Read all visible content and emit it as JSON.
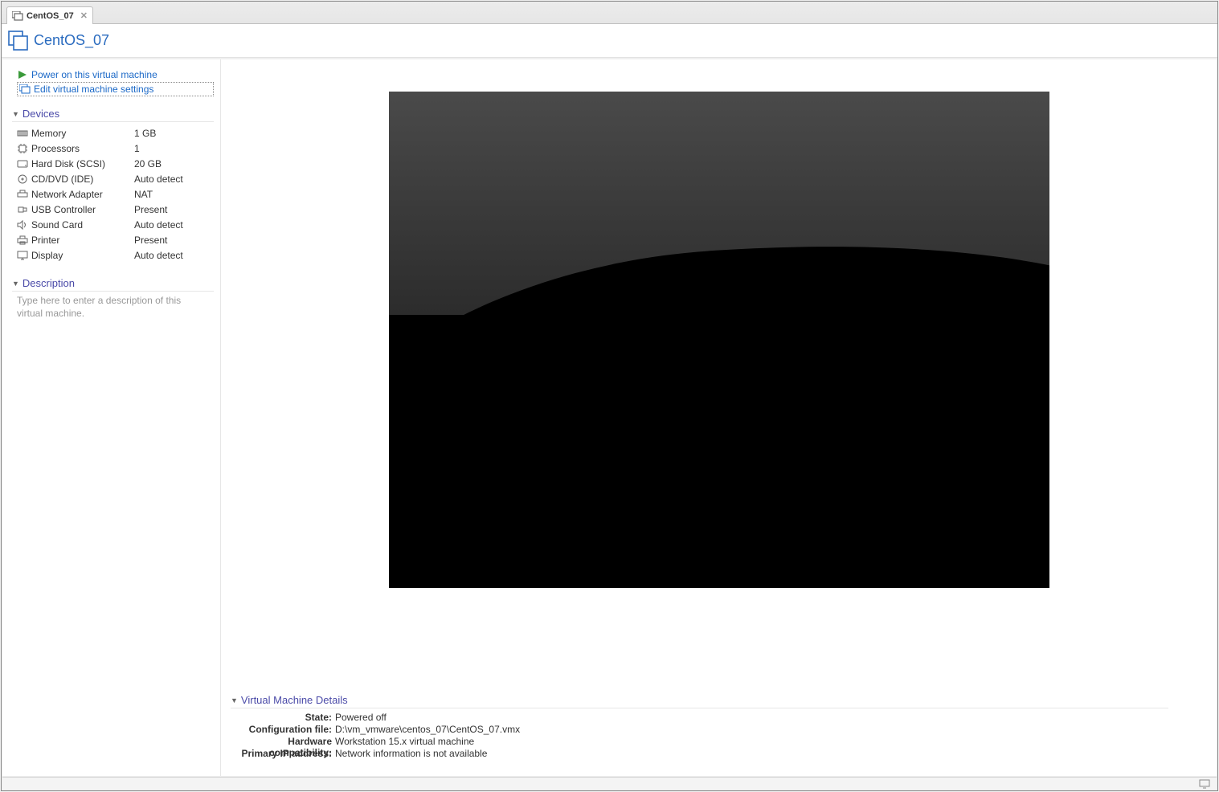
{
  "tab": {
    "title": "CentOS_07"
  },
  "vm": {
    "title": "CentOS_07"
  },
  "actions": {
    "power_on": "Power on this virtual machine",
    "edit_settings": "Edit virtual machine settings"
  },
  "devices": {
    "header": "Devices",
    "rows": [
      {
        "name": "Memory",
        "value": "1 GB"
      },
      {
        "name": "Processors",
        "value": "1"
      },
      {
        "name": "Hard Disk (SCSI)",
        "value": "20 GB"
      },
      {
        "name": "CD/DVD (IDE)",
        "value": "Auto detect"
      },
      {
        "name": "Network Adapter",
        "value": "NAT"
      },
      {
        "name": "USB Controller",
        "value": "Present"
      },
      {
        "name": "Sound Card",
        "value": "Auto detect"
      },
      {
        "name": "Printer",
        "value": "Present"
      },
      {
        "name": "Display",
        "value": "Auto detect"
      }
    ]
  },
  "description": {
    "header": "Description",
    "placeholder": "Type here to enter a description of this virtual machine."
  },
  "details": {
    "header": "Virtual Machine Details",
    "rows": [
      {
        "label": "State:",
        "value": "Powered off"
      },
      {
        "label": "Configuration file:",
        "value": "D:\\vm_vmware\\centos_07\\CentOS_07.vmx"
      },
      {
        "label": "Hardware compatibility:",
        "value": "Workstation 15.x virtual machine"
      },
      {
        "label": "Primary IP address:",
        "value": "Network information is not available"
      }
    ]
  }
}
